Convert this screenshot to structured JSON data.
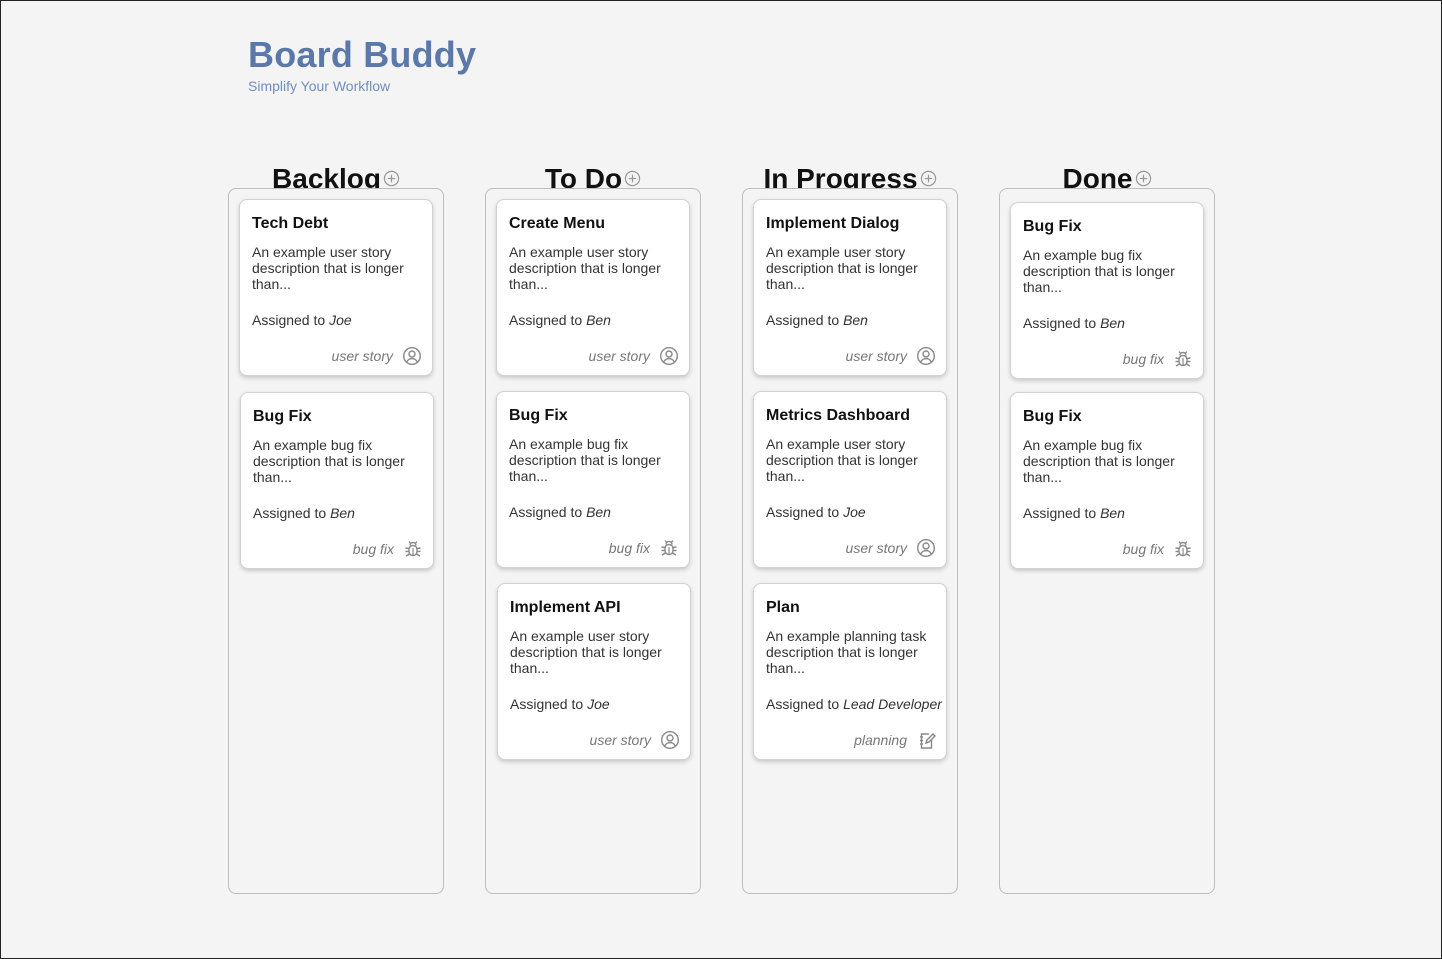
{
  "app": {
    "title": "Board Buddy",
    "subtitle": "Simplify Your Workflow"
  },
  "columns": [
    {
      "title": "Backlog",
      "cards": [
        {
          "title": "Tech Debt",
          "description": "An example user story description that is longer than...",
          "assigned_prefix": "Assigned to",
          "assignee": "Joe",
          "type": "user story",
          "icon": "user-story-icon"
        },
        {
          "title": "Bug Fix",
          "description": "An example bug fix description that is longer than...",
          "assigned_prefix": "Assigned to",
          "assignee": "Ben",
          "type": "bug fix",
          "icon": "bug-icon"
        }
      ]
    },
    {
      "title": "To Do",
      "cards": [
        {
          "title": "Create Menu",
          "description": "An example user story description that is longer than...",
          "assigned_prefix": "Assigned to",
          "assignee": "Ben",
          "type": "user story",
          "icon": "user-story-icon"
        },
        {
          "title": "Bug Fix",
          "description": "An example bug fix description that is longer than...",
          "assigned_prefix": "Assigned to",
          "assignee": "Ben",
          "type": "bug fix",
          "icon": "bug-icon"
        },
        {
          "title": "Implement API",
          "description": "An example user story description that is longer than...",
          "assigned_prefix": "Assigned to",
          "assignee": "Joe",
          "type": "user story",
          "icon": "user-story-icon"
        }
      ]
    },
    {
      "title": "In Progress",
      "cards": [
        {
          "title": "Implement Dialog",
          "description": "An example user story description that is longer than...",
          "assigned_prefix": "Assigned to",
          "assignee": "Ben",
          "type": "user story",
          "icon": "user-story-icon"
        },
        {
          "title": "Metrics Dashboard",
          "description": "An example user story description that is longer than...",
          "assigned_prefix": "Assigned to",
          "assignee": "Joe",
          "type": "user story",
          "icon": "user-story-icon"
        },
        {
          "title": "Plan",
          "description": "An example planning task description that is longer than...",
          "assigned_prefix": "Assigned to",
          "assignee": "Lead Developer",
          "type": "planning",
          "icon": "planning-icon"
        }
      ]
    },
    {
      "title": "Done",
      "cards": [
        {
          "title": "Bug Fix",
          "description": "An example bug fix description that is longer than...",
          "assigned_prefix": "Assigned to",
          "assignee": "Ben",
          "type": "bug fix",
          "icon": "bug-icon"
        },
        {
          "title": "Bug Fix",
          "description": "An example bug fix description that is longer than...",
          "assigned_prefix": "Assigned to",
          "assignee": "Ben",
          "type": "bug fix",
          "icon": "bug-icon"
        }
      ]
    }
  ],
  "colors": {
    "brand": "#5a78a8",
    "brand_subtitle": "#6f8fc0",
    "background": "#f4f4f4",
    "card": "#ffffff",
    "border": "#bdbdbd"
  }
}
